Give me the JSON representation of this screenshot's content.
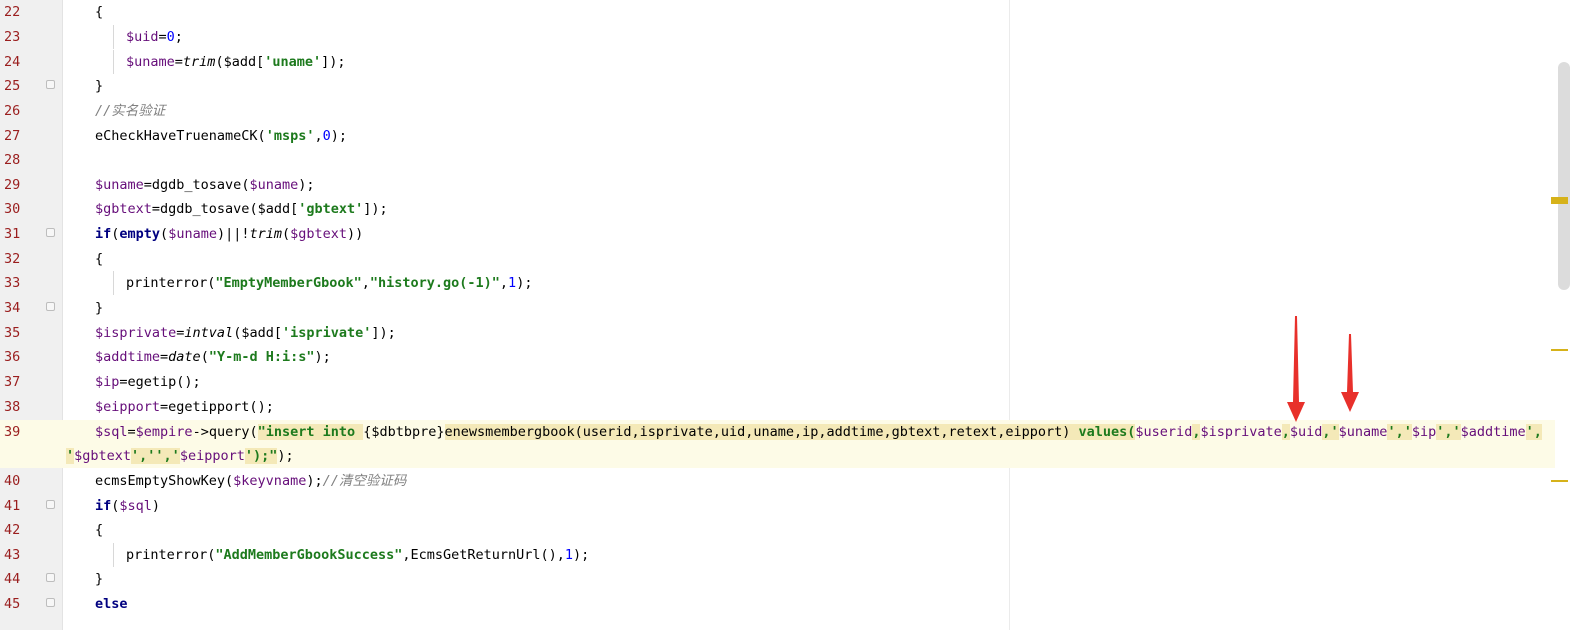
{
  "lines": [
    {
      "num": "22",
      "tokens": [
        {
          "t": "{",
          "c": ""
        }
      ]
    },
    {
      "num": "23",
      "tokens": [
        {
          "t": "$uid",
          "c": "v"
        },
        {
          "t": "=",
          "c": ""
        },
        {
          "t": "0",
          "c": "n"
        },
        {
          "t": ";",
          "c": ""
        }
      ]
    },
    {
      "num": "24",
      "tokens": [
        {
          "t": "$uname",
          "c": "v"
        },
        {
          "t": "=",
          "c": ""
        },
        {
          "t": "trim",
          "c": "i"
        },
        {
          "t": "($add[",
          "c": ""
        },
        {
          "t": "'uname'",
          "c": "s"
        },
        {
          "t": "]);",
          "c": ""
        }
      ]
    },
    {
      "num": "25",
      "tokens": [
        {
          "t": "}",
          "c": ""
        }
      ]
    },
    {
      "num": "26",
      "tokens": [
        {
          "t": "//实名验证",
          "c": "c"
        }
      ]
    },
    {
      "num": "27",
      "tokens": [
        {
          "t": "eCheckHaveTruenameCK(",
          "c": ""
        },
        {
          "t": "'msps'",
          "c": "s"
        },
        {
          "t": ",",
          "c": ""
        },
        {
          "t": "0",
          "c": "n"
        },
        {
          "t": ");",
          "c": ""
        }
      ]
    },
    {
      "num": "28",
      "tokens": []
    },
    {
      "num": "29",
      "tokens": [
        {
          "t": "$uname",
          "c": "v"
        },
        {
          "t": "=dgdb_tosave(",
          "c": ""
        },
        {
          "t": "$uname",
          "c": "v"
        },
        {
          "t": ");",
          "c": ""
        }
      ]
    },
    {
      "num": "30",
      "tokens": [
        {
          "t": "$gbtext",
          "c": "v"
        },
        {
          "t": "=dgdb_tosave($add[",
          "c": ""
        },
        {
          "t": "'gbtext'",
          "c": "s"
        },
        {
          "t": "]);",
          "c": ""
        }
      ]
    },
    {
      "num": "31",
      "tokens": [
        {
          "t": "if",
          "c": "k"
        },
        {
          "t": "(",
          "c": ""
        },
        {
          "t": "empty",
          "c": "k"
        },
        {
          "t": "(",
          "c": ""
        },
        {
          "t": "$uname",
          "c": "v"
        },
        {
          "t": ")||!",
          "c": ""
        },
        {
          "t": "trim",
          "c": "i"
        },
        {
          "t": "(",
          "c": ""
        },
        {
          "t": "$gbtext",
          "c": "v"
        },
        {
          "t": "))",
          "c": ""
        }
      ]
    },
    {
      "num": "32",
      "tokens": [
        {
          "t": "{",
          "c": ""
        }
      ]
    },
    {
      "num": "33",
      "tokens": [
        {
          "t": "printerror(",
          "c": ""
        },
        {
          "t": "\"EmptyMemberGbook\"",
          "c": "s"
        },
        {
          "t": ",",
          "c": ""
        },
        {
          "t": "\"history.go(-1)\"",
          "c": "s"
        },
        {
          "t": ",",
          "c": ""
        },
        {
          "t": "1",
          "c": "n"
        },
        {
          "t": ");",
          "c": ""
        }
      ]
    },
    {
      "num": "34",
      "tokens": [
        {
          "t": "}",
          "c": ""
        }
      ]
    },
    {
      "num": "35",
      "tokens": [
        {
          "t": "$isprivate",
          "c": "v"
        },
        {
          "t": "=",
          "c": ""
        },
        {
          "t": "intval",
          "c": "i"
        },
        {
          "t": "($add[",
          "c": ""
        },
        {
          "t": "'isprivate'",
          "c": "s"
        },
        {
          "t": "]);",
          "c": ""
        }
      ]
    },
    {
      "num": "36",
      "tokens": [
        {
          "t": "$addtime",
          "c": "v"
        },
        {
          "t": "=",
          "c": ""
        },
        {
          "t": "date",
          "c": "i"
        },
        {
          "t": "(",
          "c": ""
        },
        {
          "t": "\"Y-m-d H:i:s\"",
          "c": "s"
        },
        {
          "t": ");",
          "c": ""
        }
      ]
    },
    {
      "num": "37",
      "tokens": [
        {
          "t": "$ip",
          "c": "v"
        },
        {
          "t": "=egetip();",
          "c": ""
        }
      ]
    },
    {
      "num": "38",
      "tokens": [
        {
          "t": "$eipport",
          "c": "v"
        },
        {
          "t": "=egetipport();",
          "c": ""
        }
      ]
    },
    {
      "num": "39",
      "tokens": [
        {
          "t": "$sql",
          "c": "v"
        },
        {
          "t": "=",
          "c": ""
        },
        {
          "t": "$empire",
          "c": "v"
        },
        {
          "t": "->query(",
          "c": ""
        },
        {
          "t": "\"insert into ",
          "c": "sb"
        },
        {
          "t": "{$dbtbpre}",
          "c": ""
        },
        {
          "t": "enewsmembergbook(userid,isprivate,uid,uname,ip,addtime,gbtext,retext,eipport) ",
          "c": "sq"
        },
        {
          "t": "values(",
          "c": "sb"
        },
        {
          "t": "$userid",
          "c": "v"
        },
        {
          "t": ",",
          "c": "sb"
        },
        {
          "t": "$isprivate",
          "c": "v"
        },
        {
          "t": ",",
          "c": "sb"
        },
        {
          "t": "$uid",
          "c": "v"
        },
        {
          "t": ",'",
          "c": "sb"
        },
        {
          "t": "$uname",
          "c": "v"
        },
        {
          "t": "','",
          "c": "sb"
        },
        {
          "t": "$ip",
          "c": "v"
        },
        {
          "t": "','",
          "c": "sb"
        },
        {
          "t": "$addtime",
          "c": "v"
        },
        {
          "t": "',",
          "c": "sb"
        }
      ]
    },
    {
      "num": "",
      "tokens": [
        {
          "t": "'",
          "c": "sb"
        },
        {
          "t": "$gbtext",
          "c": "v"
        },
        {
          "t": "','','",
          "c": "sb"
        },
        {
          "t": "$eipport",
          "c": "v"
        },
        {
          "t": "');\"",
          "c": "sb"
        },
        {
          "t": ");",
          "c": ""
        }
      ]
    },
    {
      "num": "40",
      "tokens": [
        {
          "t": "ecmsEmptyShowKey(",
          "c": ""
        },
        {
          "t": "$keyvname",
          "c": "v"
        },
        {
          "t": ");",
          "c": ""
        },
        {
          "t": "//清空验证码",
          "c": "c"
        }
      ]
    },
    {
      "num": "41",
      "tokens": [
        {
          "t": "if",
          "c": "k"
        },
        {
          "t": "(",
          "c": ""
        },
        {
          "t": "$sql",
          "c": "v"
        },
        {
          "t": ")",
          "c": ""
        }
      ]
    },
    {
      "num": "42",
      "tokens": [
        {
          "t": "{",
          "c": ""
        }
      ]
    },
    {
      "num": "43",
      "tokens": [
        {
          "t": "printerror(",
          "c": ""
        },
        {
          "t": "\"AddMemberGbookSuccess\"",
          "c": "s"
        },
        {
          "t": ",EcmsGetReturnUrl(),",
          "c": ""
        },
        {
          "t": "1",
          "c": "n"
        },
        {
          "t": ");",
          "c": ""
        }
      ]
    },
    {
      "num": "44",
      "tokens": [
        {
          "t": "}",
          "c": ""
        }
      ]
    },
    {
      "num": "45",
      "tokens": [
        {
          "t": "else",
          "c": "k"
        }
      ]
    }
  ],
  "markers": [
    {
      "kind": "warning",
      "color": "#d6b21a"
    },
    {
      "kind": "info",
      "color": "#d6b21a"
    },
    {
      "kind": "info",
      "color": "#d6b21a"
    }
  ],
  "annotations": [
    {
      "kind": "arrow",
      "color": "#e8302b",
      "target": "$uid"
    },
    {
      "kind": "arrow",
      "color": "#e8302b",
      "target": "$uname"
    }
  ]
}
